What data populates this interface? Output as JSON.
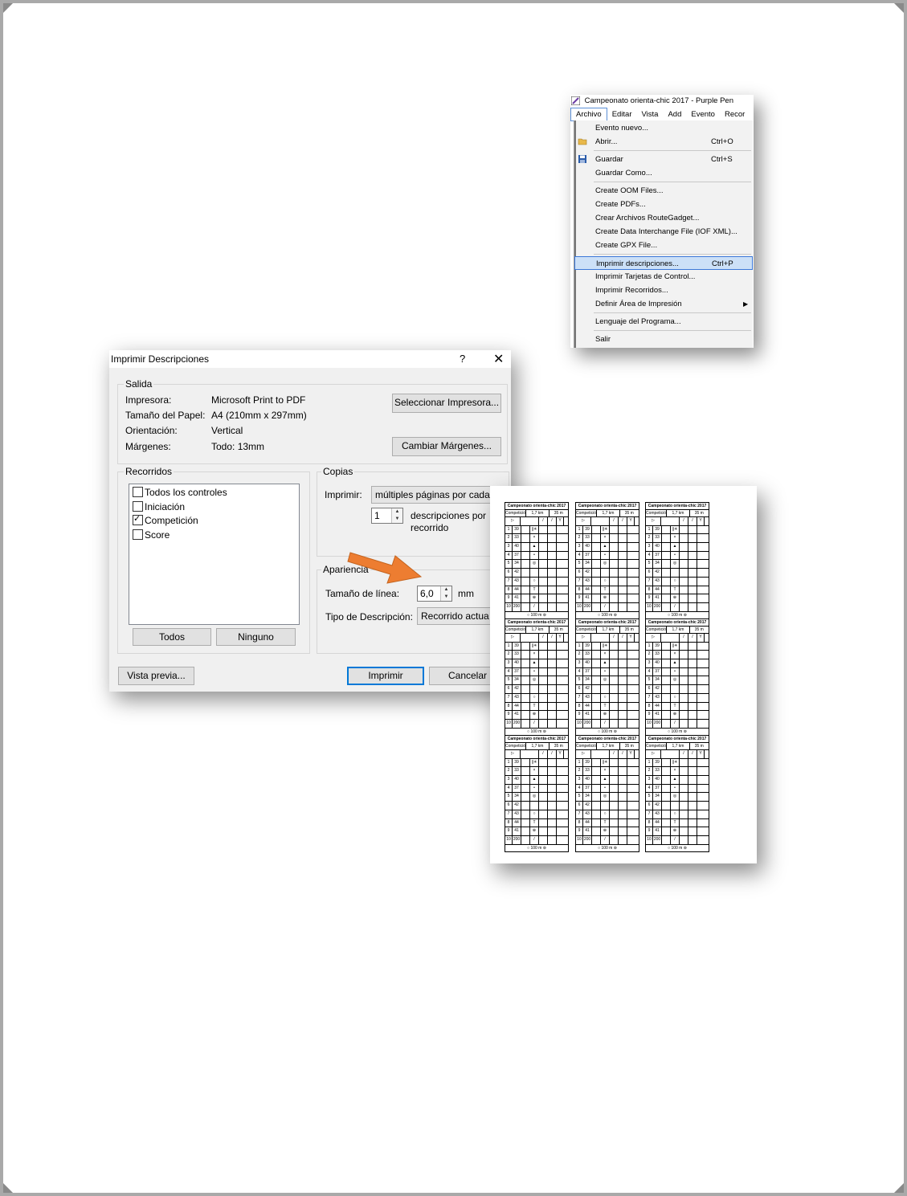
{
  "menu": {
    "window_title": "Campeonato orienta-chic 2017 - Purple Pen",
    "menubar": [
      "Archivo",
      "Editar",
      "Vista",
      "Add",
      "Evento",
      "Recor"
    ],
    "items": [
      {
        "label": "Evento nuevo...",
        "shortcut": ""
      },
      {
        "label": "Abrir...",
        "shortcut": "Ctrl+O",
        "icon": "folder-icon"
      },
      {
        "label": "Guardar",
        "shortcut": "Ctrl+S",
        "icon": "save-icon"
      },
      {
        "label": "Guardar Como...",
        "shortcut": ""
      },
      {
        "label": "Create OOM Files...",
        "shortcut": ""
      },
      {
        "label": "Create PDFs...",
        "shortcut": ""
      },
      {
        "label": "Crear Archivos RouteGadget...",
        "shortcut": ""
      },
      {
        "label": "Create Data Interchange File (IOF XML)...",
        "shortcut": ""
      },
      {
        "label": "Create GPX File...",
        "shortcut": ""
      },
      {
        "label": "Imprimir descripciones...",
        "shortcut": "Ctrl+P",
        "selected": true
      },
      {
        "label": "Imprimir Tarjetas de Control...",
        "shortcut": ""
      },
      {
        "label": "Imprimir Recorridos...",
        "shortcut": ""
      },
      {
        "label": "Definir Área de Impresión",
        "shortcut": "",
        "submenu": true
      },
      {
        "label": "Lenguaje del Programa...",
        "shortcut": ""
      },
      {
        "label": "Salir",
        "shortcut": ""
      }
    ]
  },
  "dialog": {
    "title": "Imprimir Descripciones",
    "help": "?",
    "close": "✕",
    "salida": {
      "label": "Salida",
      "impresora_label": "Impresora:",
      "impresora_value": "Microsoft Print to PDF",
      "papel_label": "Tamaño del Papel:",
      "papel_value": "A4 (210mm x 297mm)",
      "orientacion_label": "Orientación:",
      "orientacion_value": "Vertical",
      "margenes_label": "Márgenes:",
      "margenes_value": "Todo: 13mm",
      "select_printer_button": "Seleccionar Impresora...",
      "change_margins_button": "Cambiar Márgenes..."
    },
    "recorridos": {
      "label": "Recorridos",
      "items": [
        {
          "label": "Todos los controles",
          "checked": false
        },
        {
          "label": "Iniciación",
          "checked": false
        },
        {
          "label": "Competición",
          "checked": true
        },
        {
          "label": "Score",
          "checked": false
        }
      ],
      "all_button": "Todos",
      "none_button": "Ninguno"
    },
    "copias": {
      "label": "Copias",
      "imprimir_label": "Imprimir:",
      "imprimir_value": "múltiples páginas por cada",
      "count_value": "1",
      "count_suffix_1": "descripciones por",
      "count_suffix_2": "recorrido"
    },
    "apariencia": {
      "label": "Apariencia",
      "line_label": "Tamaño de línea:",
      "line_value": "6,0",
      "line_unit": "mm",
      "desc_type_label": "Tipo de Descripción:",
      "desc_type_value": "Recorrido actua"
    },
    "preview_button": "Vista previa...",
    "print_button": "Imprimir",
    "cancel_button": "Cancelar"
  },
  "sheet": {
    "card": {
      "title": "Campeonato orienta-chic 2017",
      "class": "Competición",
      "length": "1,7 km",
      "climb": "35 m",
      "controls": [
        {
          "n": "1",
          "code": "39"
        },
        {
          "n": "2",
          "code": "33"
        },
        {
          "n": "3",
          "code": "40"
        },
        {
          "n": "4",
          "code": "37"
        },
        {
          "n": "5",
          "code": "34"
        },
        {
          "n": "6",
          "code": "42"
        },
        {
          "n": "7",
          "code": "43"
        },
        {
          "n": "8",
          "code": "44"
        },
        {
          "n": "9",
          "code": "41"
        },
        {
          "n": "10",
          "code": "200"
        }
      ],
      "finish": "100 m"
    }
  },
  "colors": {
    "arrow": "#ed7d31",
    "accent": "#0078d7",
    "menu_selected": "#cce0f7"
  }
}
